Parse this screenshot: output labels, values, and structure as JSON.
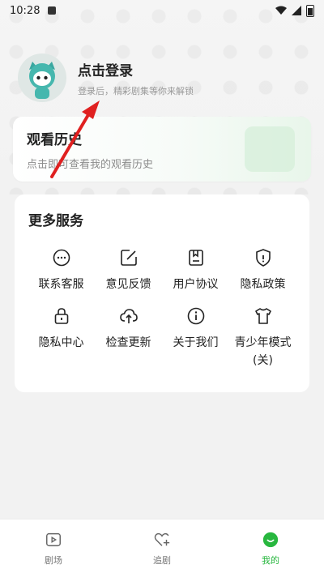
{
  "status_bar": {
    "time": "10:28"
  },
  "profile": {
    "title": "点击登录",
    "subtitle": "登录后，精彩剧集等你来解锁"
  },
  "history": {
    "title": "观看历史",
    "subtitle": "点击即可查看我的观看历史"
  },
  "services": {
    "title": "更多服务",
    "items": [
      {
        "label": "联系客服",
        "icon": "chat-bubble-icon"
      },
      {
        "label": "意见反馈",
        "icon": "edit-feedback-icon"
      },
      {
        "label": "用户协议",
        "icon": "bookmark-document-icon"
      },
      {
        "label": "隐私政策",
        "icon": "shield-icon"
      },
      {
        "label": "隐私中心",
        "icon": "lock-icon"
      },
      {
        "label": "检查更新",
        "icon": "cloud-upload-icon"
      },
      {
        "label": "关于我们",
        "icon": "info-icon"
      },
      {
        "label": "青少年模式\n(关)",
        "icon": "shirt-icon"
      }
    ]
  },
  "bottom_nav": {
    "tabs": [
      {
        "label": "剧场",
        "icon": "theater-icon"
      },
      {
        "label": "追剧",
        "icon": "heart-plus-icon"
      },
      {
        "label": "我的",
        "icon": "profile-smile-icon"
      }
    ],
    "active_index": 2
  },
  "colors": {
    "accent": "#28b73f",
    "arrow": "#e02020"
  }
}
